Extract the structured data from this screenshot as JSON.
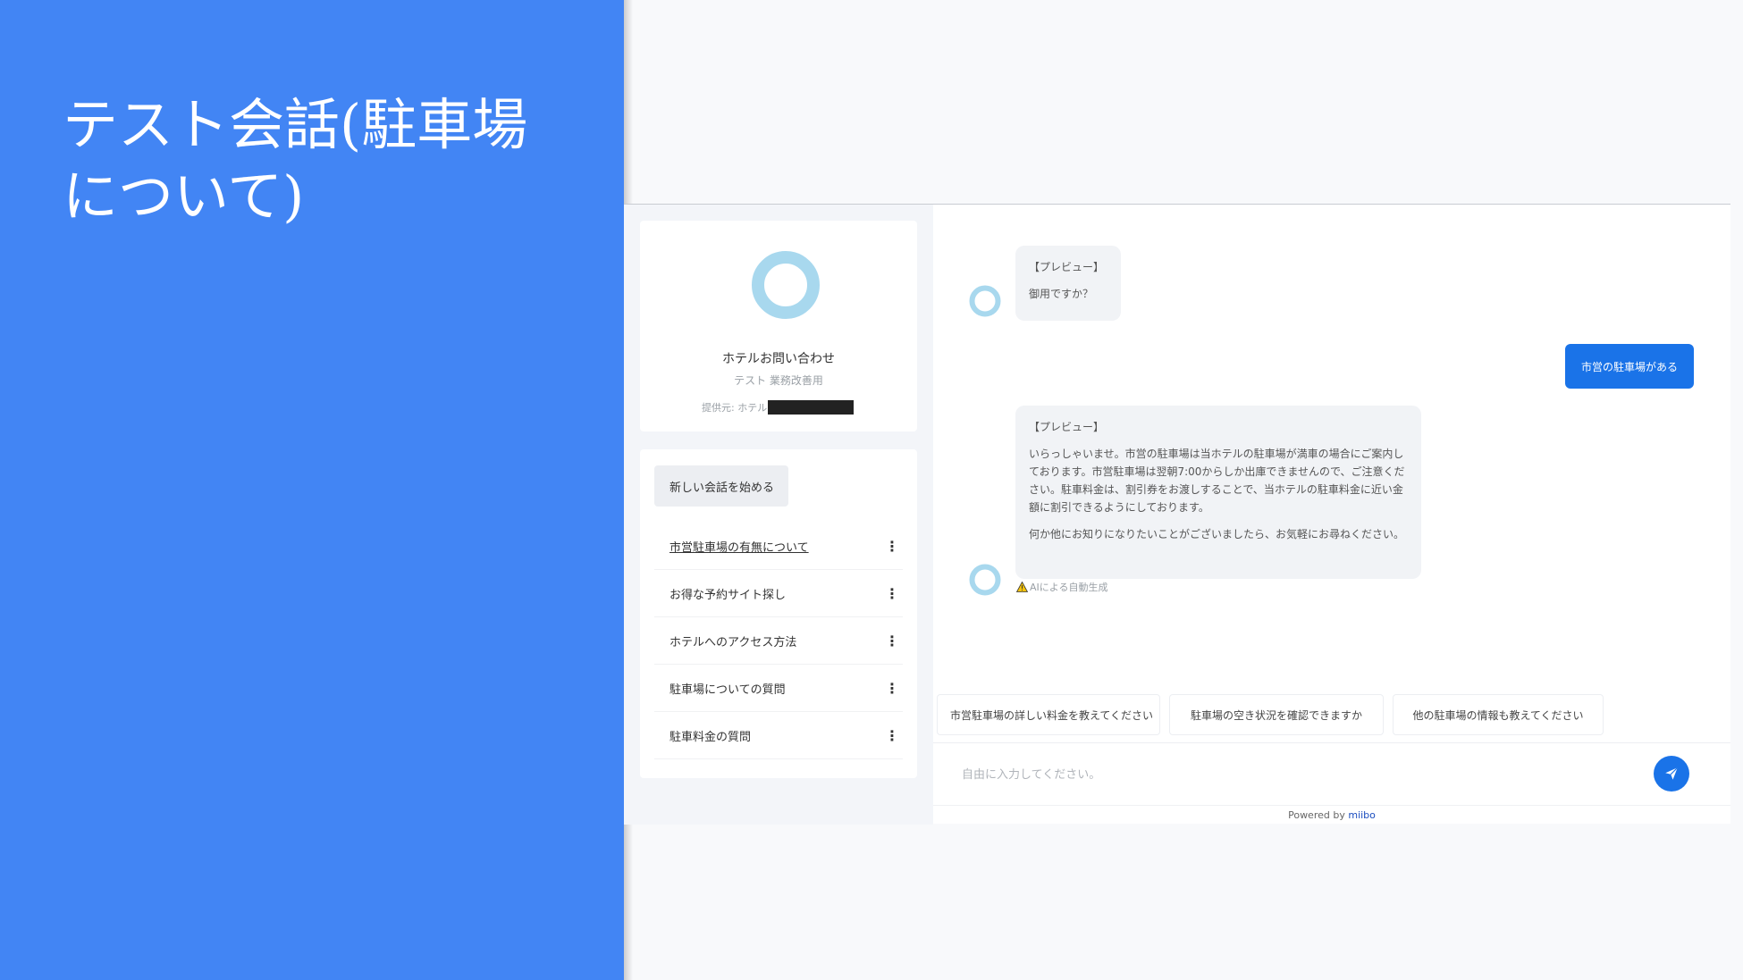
{
  "slide": {
    "title_line1": "テスト会話(駐車場",
    "title_line2": "について)",
    "background_color": "#4285f4"
  },
  "sidebar": {
    "bot_name": "ホテルお問い合わせ",
    "bot_subtitle": "テスト 業務改善用",
    "provider_label": "提供元: ホテル",
    "new_chat_label": "新しい会話を始める",
    "history": [
      {
        "label": "市営駐車場の有無について",
        "active": true
      },
      {
        "label": "お得な予約サイト探し",
        "active": false
      },
      {
        "label": "ホテルへのアクセス方法",
        "active": false
      },
      {
        "label": "駐車場についての質問",
        "active": false
      },
      {
        "label": "駐車料金の質問",
        "active": false
      }
    ],
    "menu_icon": "⋮"
  },
  "chat": {
    "messages": [
      {
        "role": "bot",
        "tag": "【プレビュー】",
        "text": "御用ですか？"
      },
      {
        "role": "user",
        "text": "市営の駐車場がある"
      },
      {
        "role": "bot",
        "tag": "【プレビュー】",
        "text": "いらっしゃいませ。市営の駐車場は当ホテルの駐車場が満車の場合にご案内しております。市営駐車場は翌朝7:00からしか出庫できませんので、ご注意ください。駐車料金は、割引券をお渡しすることで、当ホテルの駐車料金に近い金額に割引できるようにしております。",
        "text2": "何か他にお知りになりたいことがございましたら、お気軽にお尋ねください。"
      }
    ],
    "ai_note": "AIによる自動生成",
    "suggestions": [
      "市営駐車場の詳しい料金を教えてください",
      "駐車場の空き状況を確認できますか",
      "他の駐車場の情報も教えてください"
    ],
    "input_placeholder": "自由に入力してください。",
    "powered_by": "Powered by",
    "brand": "miibo",
    "accent_color": "#1a73e8"
  }
}
